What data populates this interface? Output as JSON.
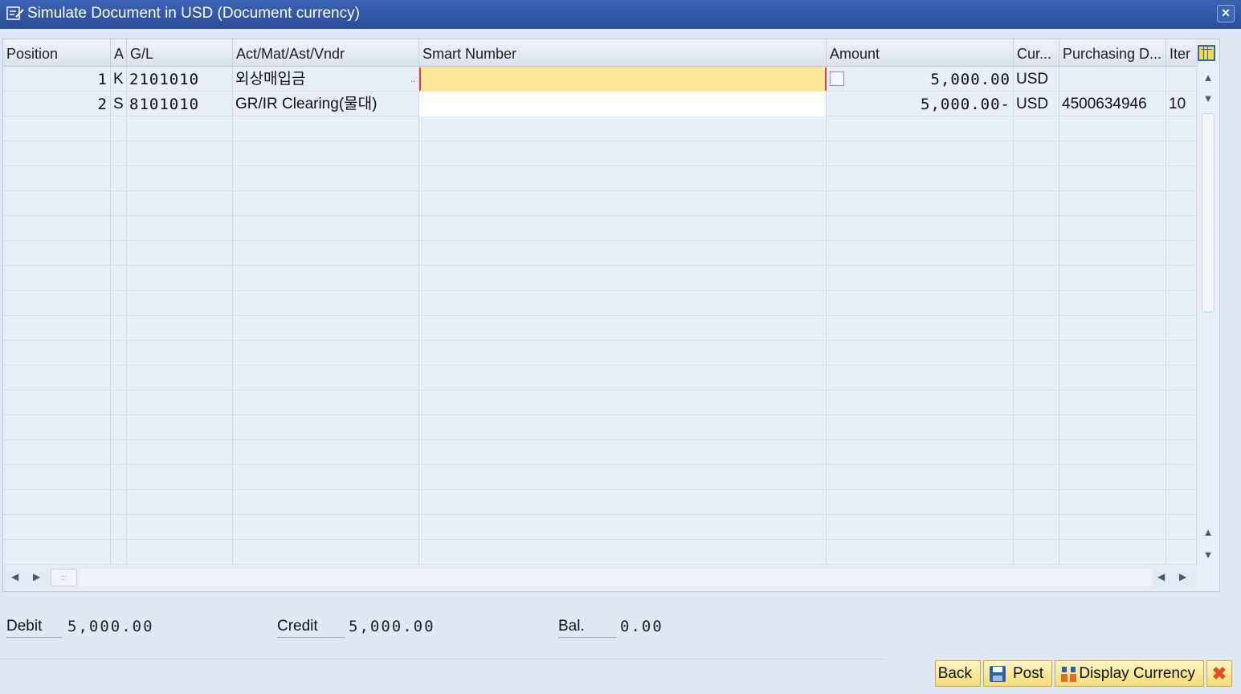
{
  "window": {
    "title": "Simulate Document in USD (Document currency)"
  },
  "columns": {
    "position": "Position",
    "a": "A",
    "gl": "G/L",
    "act": "Act/Mat/Ast/Vndr",
    "smart": "Smart Number",
    "amount": "Amount",
    "cur": "Cur...",
    "purch": "Purchasing D...",
    "item": "Iter"
  },
  "rows": [
    {
      "position": "1",
      "a": "K",
      "gl": "2101010",
      "act": "외상매입금",
      "act_more": "..",
      "smart": "",
      "amount": "5,000.00",
      "cur": "USD",
      "purch": "",
      "item": ""
    },
    {
      "position": "2",
      "a": "S",
      "gl": "8101010",
      "act": "GR/IR Clearing(물대)",
      "act_more": "",
      "smart": "",
      "amount": "5,000.00-",
      "cur": "USD",
      "purch": "4500634946",
      "item": "10"
    }
  ],
  "totals": {
    "debit_label": "Debit",
    "debit_value": "5,000.00",
    "credit_label": "Credit",
    "credit_value": "5,000.00",
    "bal_label": "Bal.",
    "bal_value": "0.00"
  },
  "buttons": {
    "back": "Back",
    "post": "Post",
    "display_currency": "Display Currency"
  },
  "colors": {
    "title_bar": "#2a4d99",
    "active_cell": "#fbe69a",
    "button": "#f4dc78",
    "cancel": "#e05020"
  }
}
